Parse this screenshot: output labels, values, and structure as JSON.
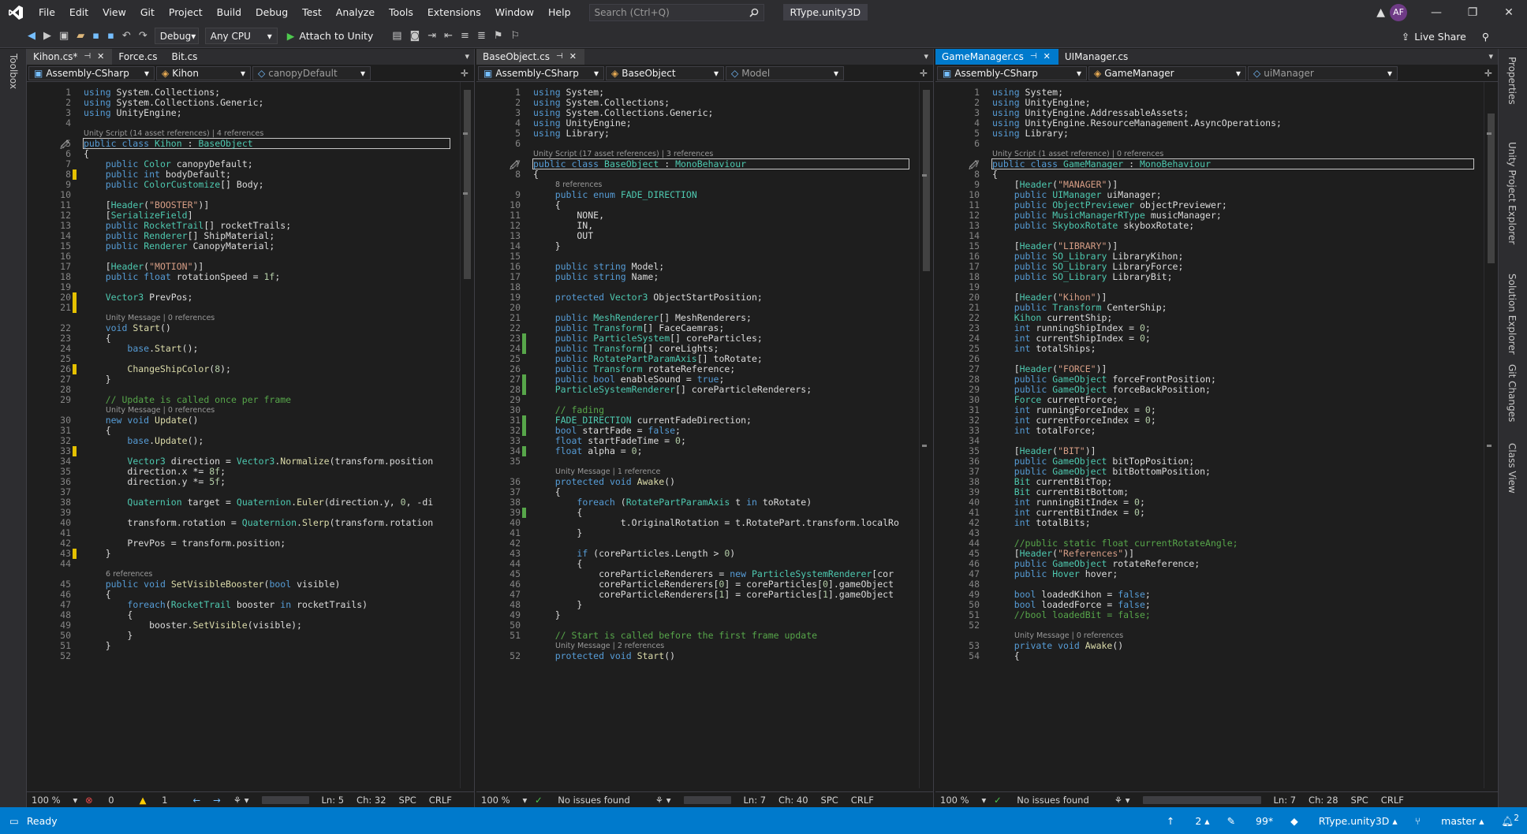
{
  "app": {
    "title": "RType.unity3D",
    "search_placeholder": "Search (Ctrl+Q)",
    "user_initials": "AF"
  },
  "menu": [
    "File",
    "Edit",
    "View",
    "Git",
    "Project",
    "Build",
    "Debug",
    "Test",
    "Analyze",
    "Tools",
    "Extensions",
    "Window",
    "Help"
  ],
  "toolbar": {
    "config": "Debug",
    "platform": "Any CPU",
    "attach": "Attach to Unity",
    "live_share": "Live Share"
  },
  "side_tabs": {
    "left": [
      "Toolbox"
    ],
    "right": [
      "Properties",
      "Unity Project Explorer",
      "Solution Explorer",
      "Git Changes",
      "Class View"
    ]
  },
  "panes": [
    {
      "tabs": [
        {
          "label": "Kihon.cs*",
          "state": "current"
        },
        {
          "label": "Force.cs",
          "state": "normal"
        },
        {
          "label": "Bit.cs",
          "state": "normal"
        }
      ],
      "nav": [
        "Assembly-CSharp",
        "Kihon",
        "canopyDefault"
      ],
      "highlight_line": 5,
      "lenses": [
        {
          "after": 4,
          "text": "Unity Script (14 asset references) | 4 references"
        },
        {
          "after": 21,
          "text": "Unity Message | 0 references"
        },
        {
          "after": 29,
          "text": "Unity Message | 0 references"
        },
        {
          "after": 44,
          "text": "6 references"
        }
      ],
      "lines": [
        {
          "n": 1,
          "h": "<span class=k>using</span> System.Collections;"
        },
        {
          "n": 2,
          "h": "<span class=k>using</span> System.Collections.Generic;"
        },
        {
          "n": 3,
          "h": "<span class=k>using</span> UnityEngine;"
        },
        {
          "n": 4,
          "h": ""
        },
        {
          "n": 5,
          "h": "<span class=k>public class</span> <span class=t>Kihon</span> : <span class=t>BaseObject</span>"
        },
        {
          "n": 6,
          "h": "{"
        },
        {
          "n": 7,
          "h": "    <span class=k>public</span> <span class=t>Color</span> canopyDefault;"
        },
        {
          "n": 8,
          "h": "    <span class=k>public int</span> bodyDefault;"
        },
        {
          "n": 9,
          "h": "    <span class=k>public</span> <span class=t>ColorCustomize</span>[] Body;"
        },
        {
          "n": 10,
          "h": ""
        },
        {
          "n": 11,
          "h": "    [<span class=t>Header</span>(<span class=s>\"BOOSTER\"</span>)]"
        },
        {
          "n": 12,
          "h": "    [<span class=t>SerializeField</span>]"
        },
        {
          "n": 13,
          "h": "    <span class=k>public</span> <span class=t>RocketTrail</span>[] rocketTrails;"
        },
        {
          "n": 14,
          "h": "    <span class=k>public</span> <span class=t>Renderer</span>[] ShipMaterial;"
        },
        {
          "n": 15,
          "h": "    <span class=k>public</span> <span class=t>Renderer</span> CanopyMaterial;"
        },
        {
          "n": 16,
          "h": ""
        },
        {
          "n": 17,
          "h": "    [<span class=t>Header</span>(<span class=s>\"MOTION\"</span>)]"
        },
        {
          "n": 18,
          "h": "    <span class=k>public float</span> rotationSpeed = <span class=n>1f</span>;"
        },
        {
          "n": 19,
          "h": ""
        },
        {
          "n": 20,
          "h": "    <span class=t>Vector3</span> PrevPos;"
        },
        {
          "n": 21,
          "h": ""
        },
        {
          "n": 22,
          "h": "    <span class=k>void</span> <span class=m>Start</span>()"
        },
        {
          "n": 23,
          "h": "    {"
        },
        {
          "n": 24,
          "h": "        <span class=k>base</span>.<span class=m>Start</span>();"
        },
        {
          "n": 25,
          "h": ""
        },
        {
          "n": 26,
          "h": "        <span class=m>ChangeShipColor</span>(<span class=n>8</span>);"
        },
        {
          "n": 27,
          "h": "    }"
        },
        {
          "n": 28,
          "h": ""
        },
        {
          "n": 29,
          "h": "    <span class=c>// Update is called once per frame</span>"
        },
        {
          "n": 30,
          "h": "    <span class=k>new void</span> <span class=m>Update</span>()"
        },
        {
          "n": 31,
          "h": "    {"
        },
        {
          "n": 32,
          "h": "        <span class=k>base</span>.<span class=m>Update</span>();"
        },
        {
          "n": 33,
          "h": ""
        },
        {
          "n": 34,
          "h": "        <span class=t>Vector3</span> direction = <span class=t>Vector3</span>.<span class=m>Normalize</span>(transform.position"
        },
        {
          "n": 35,
          "h": "        direction.x *= <span class=n>8f</span>;"
        },
        {
          "n": 36,
          "h": "        direction.y *= <span class=n>5f</span>;"
        },
        {
          "n": 37,
          "h": ""
        },
        {
          "n": 38,
          "h": "        <span class=t>Quaternion</span> target = <span class=t>Quaternion</span>.<span class=m>Euler</span>(direction.y, <span class=n>0</span>, -di"
        },
        {
          "n": 39,
          "h": ""
        },
        {
          "n": 40,
          "h": "        transform.rotation = <span class=t>Quaternion</span>.<span class=m>Slerp</span>(transform.rotation"
        },
        {
          "n": 41,
          "h": ""
        },
        {
          "n": 42,
          "h": "        PrevPos = transform.position;"
        },
        {
          "n": 43,
          "h": "    }"
        },
        {
          "n": 44,
          "h": ""
        },
        {
          "n": 45,
          "h": "    <span class=k>public void</span> <span class=m>SetVisibleBooster</span>(<span class=k>bool</span> visible)"
        },
        {
          "n": 46,
          "h": "    {"
        },
        {
          "n": 47,
          "h": "        <span class=k>foreach</span>(<span class=t>RocketTrail</span> booster <span class=k>in</span> rocketTrails)"
        },
        {
          "n": 48,
          "h": "        {"
        },
        {
          "n": 49,
          "h": "            booster.<span class=m>SetVisible</span>(visible);"
        },
        {
          "n": 50,
          "h": "        }"
        },
        {
          "n": 51,
          "h": "    }"
        },
        {
          "n": 52,
          "h": ""
        }
      ],
      "status": {
        "zoom": "100 %",
        "errors": "0",
        "warnings": "1",
        "ln": "Ln: 5",
        "ch": "Ch: 32",
        "spc": "SPC",
        "eol": "CRLF"
      }
    },
    {
      "tabs": [
        {
          "label": "BaseObject.cs",
          "state": "current"
        }
      ],
      "nav": [
        "Assembly-CSharp",
        "BaseObject",
        "Model"
      ],
      "highlight_line": 7,
      "lenses": [
        {
          "after": 6,
          "text": "Unity Script (17 asset references) | 3 references"
        },
        {
          "after": 8,
          "text": "8 references"
        },
        {
          "after": 35,
          "text": "Unity Message | 1 reference"
        },
        {
          "after": 51,
          "text": "Unity Message | 2 references"
        }
      ],
      "lines": [
        {
          "n": 1,
          "h": "<span class=k>using</span> System;"
        },
        {
          "n": 2,
          "h": "<span class=k>using</span> System.Collections;"
        },
        {
          "n": 3,
          "h": "<span class=k>using</span> System.Collections.Generic;"
        },
        {
          "n": 4,
          "h": "<span class=k>using</span> UnityEngine;"
        },
        {
          "n": 5,
          "h": "<span class=k>using</span> Library;"
        },
        {
          "n": 6,
          "h": ""
        },
        {
          "n": 7,
          "h": "<span class=k>public class</span> <span class=t>BaseObject</span> : <span class=t>MonoBehaviour</span>"
        },
        {
          "n": 8,
          "h": "{"
        },
        {
          "n": 9,
          "h": "    <span class=k>public enum</span> <span class=t>FADE_DIRECTION</span>"
        },
        {
          "n": 10,
          "h": "    {"
        },
        {
          "n": 11,
          "h": "        NONE,"
        },
        {
          "n": 12,
          "h": "        IN,"
        },
        {
          "n": 13,
          "h": "        OUT"
        },
        {
          "n": 14,
          "h": "    }"
        },
        {
          "n": 15,
          "h": ""
        },
        {
          "n": 16,
          "h": "    <span class=k>public string</span> Model;"
        },
        {
          "n": 17,
          "h": "    <span class=k>public string</span> Name;"
        },
        {
          "n": 18,
          "h": ""
        },
        {
          "n": 19,
          "h": "    <span class=k>protected</span> <span class=t>Vector3</span> ObjectStartPosition;"
        },
        {
          "n": 20,
          "h": ""
        },
        {
          "n": 21,
          "h": "    <span class=k>public</span> <span class=t>MeshRenderer</span>[] MeshRenderers;"
        },
        {
          "n": 22,
          "h": "    <span class=k>public</span> <span class=t>Transform</span>[] FaceCaemras;"
        },
        {
          "n": 23,
          "h": "    <span class=k>public</span> <span class=t>ParticleSystem</span>[] coreParticles;"
        },
        {
          "n": 24,
          "h": "    <span class=k>public</span> <span class=t>Transform</span>[] coreLights;"
        },
        {
          "n": 25,
          "h": "    <span class=k>public</span> <span class=t>RotatePartParamAxis</span>[] toRotate;"
        },
        {
          "n": 26,
          "h": "    <span class=k>public</span> <span class=t>Transform</span> rotateReference;"
        },
        {
          "n": 27,
          "h": "    <span class=k>public bool</span> enableSound = <span class=k>true</span>;"
        },
        {
          "n": 28,
          "h": "    <span class=t>ParticleSystemRenderer</span>[] coreParticleRenderers;"
        },
        {
          "n": 29,
          "h": ""
        },
        {
          "n": 30,
          "h": "    <span class=c>// fading</span>"
        },
        {
          "n": 31,
          "h": "    <span class=t>FADE_DIRECTION</span> currentFadeDirection;"
        },
        {
          "n": 32,
          "h": "    <span class=k>bool</span> startFade = <span class=k>false</span>;"
        },
        {
          "n": 33,
          "h": "    <span class=k>float</span> startFadeTime = <span class=n>0</span>;"
        },
        {
          "n": 34,
          "h": "    <span class=k>float</span> alpha = <span class=n>0</span>;"
        },
        {
          "n": 35,
          "h": ""
        },
        {
          "n": 36,
          "h": "    <span class=k>protected void</span> <span class=m>Awake</span>()"
        },
        {
          "n": 37,
          "h": "    {"
        },
        {
          "n": 38,
          "h": "        <span class=k>foreach</span> (<span class=t>RotatePartParamAxis</span> t <span class=k>in</span> toRotate)"
        },
        {
          "n": 39,
          "h": "        {"
        },
        {
          "n": 40,
          "h": "                t.OriginalRotation = t.RotatePart.transform.localRo"
        },
        {
          "n": 41,
          "h": "        }"
        },
        {
          "n": 42,
          "h": ""
        },
        {
          "n": 43,
          "h": "        <span class=k>if</span> (coreParticles.Length > <span class=n>0</span>)"
        },
        {
          "n": 44,
          "h": "        {"
        },
        {
          "n": 45,
          "h": "            coreParticleRenderers = <span class=k>new</span> <span class=t>ParticleSystemRenderer</span>[cor"
        },
        {
          "n": 46,
          "h": "            coreParticleRenderers[<span class=n>0</span>] = coreParticles[<span class=n>0</span>].gameObject"
        },
        {
          "n": 47,
          "h": "            coreParticleRenderers[<span class=n>1</span>] = coreParticles[<span class=n>1</span>].gameObject"
        },
        {
          "n": 48,
          "h": "        }"
        },
        {
          "n": 49,
          "h": "    }"
        },
        {
          "n": 50,
          "h": ""
        },
        {
          "n": 51,
          "h": "    <span class=c>// Start is called before the first frame update</span>"
        },
        {
          "n": 52,
          "h": "    <span class=k>protected void</span> <span class=m>Start</span>()"
        }
      ],
      "status": {
        "zoom": "100 %",
        "issues": "No issues found",
        "ln": "Ln: 7",
        "ch": "Ch: 40",
        "spc": "SPC",
        "eol": "CRLF"
      }
    },
    {
      "tabs": [
        {
          "label": "GameManager.cs",
          "state": "active"
        },
        {
          "label": "UIManager.cs",
          "state": "normal"
        }
      ],
      "nav": [
        "Assembly-CSharp",
        "GameManager",
        "uiManager"
      ],
      "highlight_line": 7,
      "lenses": [
        {
          "after": 6,
          "text": "Unity Script (1 asset reference) | 0 references"
        },
        {
          "after": 52,
          "text": "Unity Message | 0 references"
        }
      ],
      "lines": [
        {
          "n": 1,
          "h": "<span class=k>using</span> System;"
        },
        {
          "n": 2,
          "h": "<span class=k>using</span> UnityEngine;"
        },
        {
          "n": 3,
          "h": "<span class=k>using</span> UnityEngine.AddressableAssets;"
        },
        {
          "n": 4,
          "h": "<span class=k>using</span> UnityEngine.ResourceManagement.AsyncOperations;"
        },
        {
          "n": 5,
          "h": "<span class=k>using</span> Library;"
        },
        {
          "n": 6,
          "h": ""
        },
        {
          "n": 7,
          "h": "<span class=k>public class</span> <span class=t>GameManager</span> : <span class=t>MonoBehaviour</span>"
        },
        {
          "n": 8,
          "h": "{"
        },
        {
          "n": 9,
          "h": "    [<span class=t>Header</span>(<span class=s>\"MANAGER\"</span>)]"
        },
        {
          "n": 10,
          "h": "    <span class=k>public</span> <span class=t>UIManager</span> uiManager;"
        },
        {
          "n": 11,
          "h": "    <span class=k>public</span> <span class=t>ObjectPreviewer</span> objectPreviewer;"
        },
        {
          "n": 12,
          "h": "    <span class=k>public</span> <span class=t>MusicManagerRType</span> musicManager;"
        },
        {
          "n": 13,
          "h": "    <span class=k>public</span> <span class=t>SkyboxRotate</span> skyboxRotate;"
        },
        {
          "n": 14,
          "h": ""
        },
        {
          "n": 15,
          "h": "    [<span class=t>Header</span>(<span class=s>\"LIBRARY\"</span>)]"
        },
        {
          "n": 16,
          "h": "    <span class=k>public</span> <span class=t>SO_Library</span> LibraryKihon;"
        },
        {
          "n": 17,
          "h": "    <span class=k>public</span> <span class=t>SO_Library</span> LibraryForce;"
        },
        {
          "n": 18,
          "h": "    <span class=k>public</span> <span class=t>SO_Library</span> LibraryBit;"
        },
        {
          "n": 19,
          "h": ""
        },
        {
          "n": 20,
          "h": "    [<span class=t>Header</span>(<span class=s>\"Kihon\"</span>)]"
        },
        {
          "n": 21,
          "h": "    <span class=k>public</span> <span class=t>Transform</span> CenterShip;"
        },
        {
          "n": 22,
          "h": "    <span class=t>Kihon</span> currentShip;"
        },
        {
          "n": 23,
          "h": "    <span class=k>int</span> runningShipIndex = <span class=n>0</span>;"
        },
        {
          "n": 24,
          "h": "    <span class=k>int</span> currentShipIndex = <span class=n>0</span>;"
        },
        {
          "n": 25,
          "h": "    <span class=k>int</span> totalShips;"
        },
        {
          "n": 26,
          "h": ""
        },
        {
          "n": 27,
          "h": "    [<span class=t>Header</span>(<span class=s>\"FORCE\"</span>)]"
        },
        {
          "n": 28,
          "h": "    <span class=k>public</span> <span class=t>GameObject</span> forceFrontPosition;"
        },
        {
          "n": 29,
          "h": "    <span class=k>public</span> <span class=t>GameObject</span> forceBackPosition;"
        },
        {
          "n": 30,
          "h": "    <span class=t>Force</span> currentForce;"
        },
        {
          "n": 31,
          "h": "    <span class=k>int</span> runningForceIndex = <span class=n>0</span>;"
        },
        {
          "n": 32,
          "h": "    <span class=k>int</span> currentForceIndex = <span class=n>0</span>;"
        },
        {
          "n": 33,
          "h": "    <span class=k>int</span> totalForce;"
        },
        {
          "n": 34,
          "h": ""
        },
        {
          "n": 35,
          "h": "    [<span class=t>Header</span>(<span class=s>\"BIT\"</span>)]"
        },
        {
          "n": 36,
          "h": "    <span class=k>public</span> <span class=t>GameObject</span> bitTopPosition;"
        },
        {
          "n": 37,
          "h": "    <span class=k>public</span> <span class=t>GameObject</span> bitBottomPosition;"
        },
        {
          "n": 38,
          "h": "    <span class=t>Bit</span> currentBitTop;"
        },
        {
          "n": 39,
          "h": "    <span class=t>Bit</span> currentBitBottom;"
        },
        {
          "n": 40,
          "h": "    <span class=k>int</span> runningBitIndex = <span class=n>0</span>;"
        },
        {
          "n": 41,
          "h": "    <span class=k>int</span> currentBitIndex = <span class=n>0</span>;"
        },
        {
          "n": 42,
          "h": "    <span class=k>int</span> totalBits;"
        },
        {
          "n": 43,
          "h": ""
        },
        {
          "n": 44,
          "h": "    <span class=c>//public static float currentRotateAngle;</span>"
        },
        {
          "n": 45,
          "h": "    [<span class=t>Header</span>(<span class=s>\"References\"</span>)]"
        },
        {
          "n": 46,
          "h": "    <span class=k>public</span> <span class=t>GameObject</span> rotateReference;"
        },
        {
          "n": 47,
          "h": "    <span class=k>public</span> <span class=t>Hover</span> hover;"
        },
        {
          "n": 48,
          "h": ""
        },
        {
          "n": 49,
          "h": "    <span class=k>bool</span> loadedKihon = <span class=k>false</span>;"
        },
        {
          "n": 50,
          "h": "    <span class=k>bool</span> loadedForce = <span class=k>false</span>;"
        },
        {
          "n": 51,
          "h": "    <span class=c>//bool loadedBit = false;</span>"
        },
        {
          "n": 52,
          "h": ""
        },
        {
          "n": 53,
          "h": "    <span class=k>private void</span> <span class=m>Awake</span>()"
        },
        {
          "n": 54,
          "h": "    {"
        }
      ],
      "status": {
        "zoom": "100 %",
        "issues": "No issues found",
        "ln": "Ln: 7",
        "ch": "Ch: 28",
        "spc": "SPC",
        "eol": "CRLF"
      }
    }
  ],
  "statusbar": {
    "ready": "Ready",
    "up": "2",
    "edits": "99*",
    "repo": "RType.unity3D",
    "branch": "master",
    "notif": "2"
  }
}
